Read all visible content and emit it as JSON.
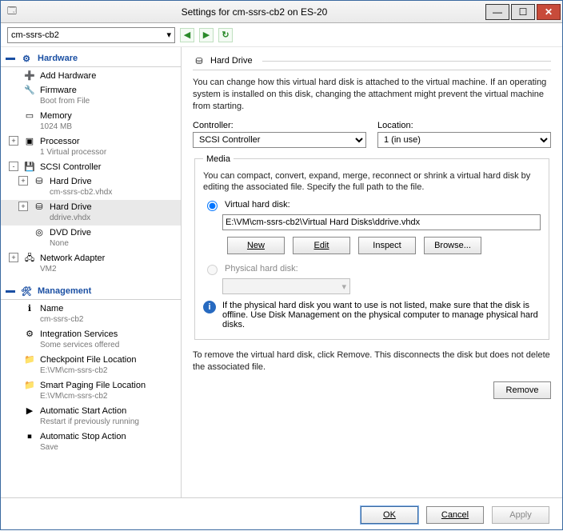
{
  "window": {
    "title": "Settings for cm-ssrs-cb2 on ES-20"
  },
  "toolbar": {
    "vm": "cm-ssrs-cb2"
  },
  "sidebar": {
    "hardware_label": "Hardware",
    "management_label": "Management",
    "hardware": [
      {
        "name": "add-hardware",
        "label": "Add Hardware",
        "sub": "",
        "icon": "➕",
        "lvl": 1
      },
      {
        "name": "firmware",
        "label": "Firmware",
        "sub": "Boot from File",
        "icon": "🔧",
        "lvl": 1
      },
      {
        "name": "memory",
        "label": "Memory",
        "sub": "1024 MB",
        "icon": "▭",
        "lvl": 1
      },
      {
        "name": "processor",
        "label": "Processor",
        "sub": "1 Virtual processor",
        "icon": "▣",
        "lvl": 1,
        "exp": "+"
      },
      {
        "name": "scsi-controller",
        "label": "SCSI Controller",
        "sub": "",
        "icon": "💾",
        "lvl": 1,
        "exp": "-"
      },
      {
        "name": "hard-drive-1",
        "label": "Hard Drive",
        "sub": "cm-ssrs-cb2.vhdx",
        "icon": "⛁",
        "lvl": 2,
        "exp": "+"
      },
      {
        "name": "hard-drive-2",
        "label": "Hard Drive",
        "sub": "ddrive.vhdx",
        "icon": "⛁",
        "lvl": 2,
        "sel": true,
        "exp": "+"
      },
      {
        "name": "dvd-drive",
        "label": "DVD Drive",
        "sub": "None",
        "icon": "◎",
        "lvl": 2
      },
      {
        "name": "network-adapter",
        "label": "Network Adapter",
        "sub": "VM2",
        "icon": "🖧",
        "lvl": 1,
        "exp": "+"
      }
    ],
    "management": [
      {
        "name": "name",
        "label": "Name",
        "sub": "cm-ssrs-cb2",
        "icon": "ℹ"
      },
      {
        "name": "integration-services",
        "label": "Integration Services",
        "sub": "Some services offered",
        "icon": "⚙"
      },
      {
        "name": "checkpoint-file-location",
        "label": "Checkpoint File Location",
        "sub": "E:\\VM\\cm-ssrs-cb2",
        "icon": "📁"
      },
      {
        "name": "smart-paging-file-location",
        "label": "Smart Paging File Location",
        "sub": "E:\\VM\\cm-ssrs-cb2",
        "icon": "📁"
      },
      {
        "name": "automatic-start-action",
        "label": "Automatic Start Action",
        "sub": "Restart if previously running",
        "icon": "▶"
      },
      {
        "name": "automatic-stop-action",
        "label": "Automatic Stop Action",
        "sub": "Save",
        "icon": "⏹"
      }
    ]
  },
  "main": {
    "title": "Hard Drive",
    "desc": "You can change how this virtual hard disk is attached to the virtual machine. If an operating system is installed on this disk, changing the attachment might prevent the virtual machine from starting.",
    "controller_label": "Controller:",
    "controller_value": "SCSI Controller",
    "location_label": "Location:",
    "location_value": "1 (in use)",
    "media_label": "Media",
    "media_desc": "You can compact, convert, expand, merge, reconnect or shrink a virtual hard disk by editing the associated file. Specify the full path to the file.",
    "vhd_radio": "Virtual hard disk:",
    "vhd_path": "E:\\VM\\cm-ssrs-cb2\\Virtual Hard Disks\\ddrive.vhdx",
    "btn_new": "New",
    "btn_edit": "Edit",
    "btn_inspect": "Inspect",
    "btn_browse": "Browse...",
    "phd_radio": "Physical hard disk:",
    "phd_info": "If the physical hard disk you want to use is not listed, make sure that the disk is offline. Use Disk Management on the physical computer to manage physical hard disks.",
    "remove_desc": "To remove the virtual hard disk, click Remove. This disconnects the disk but does not delete the associated file.",
    "btn_remove": "Remove"
  },
  "footer": {
    "ok": "OK",
    "cancel": "Cancel",
    "apply": "Apply"
  }
}
